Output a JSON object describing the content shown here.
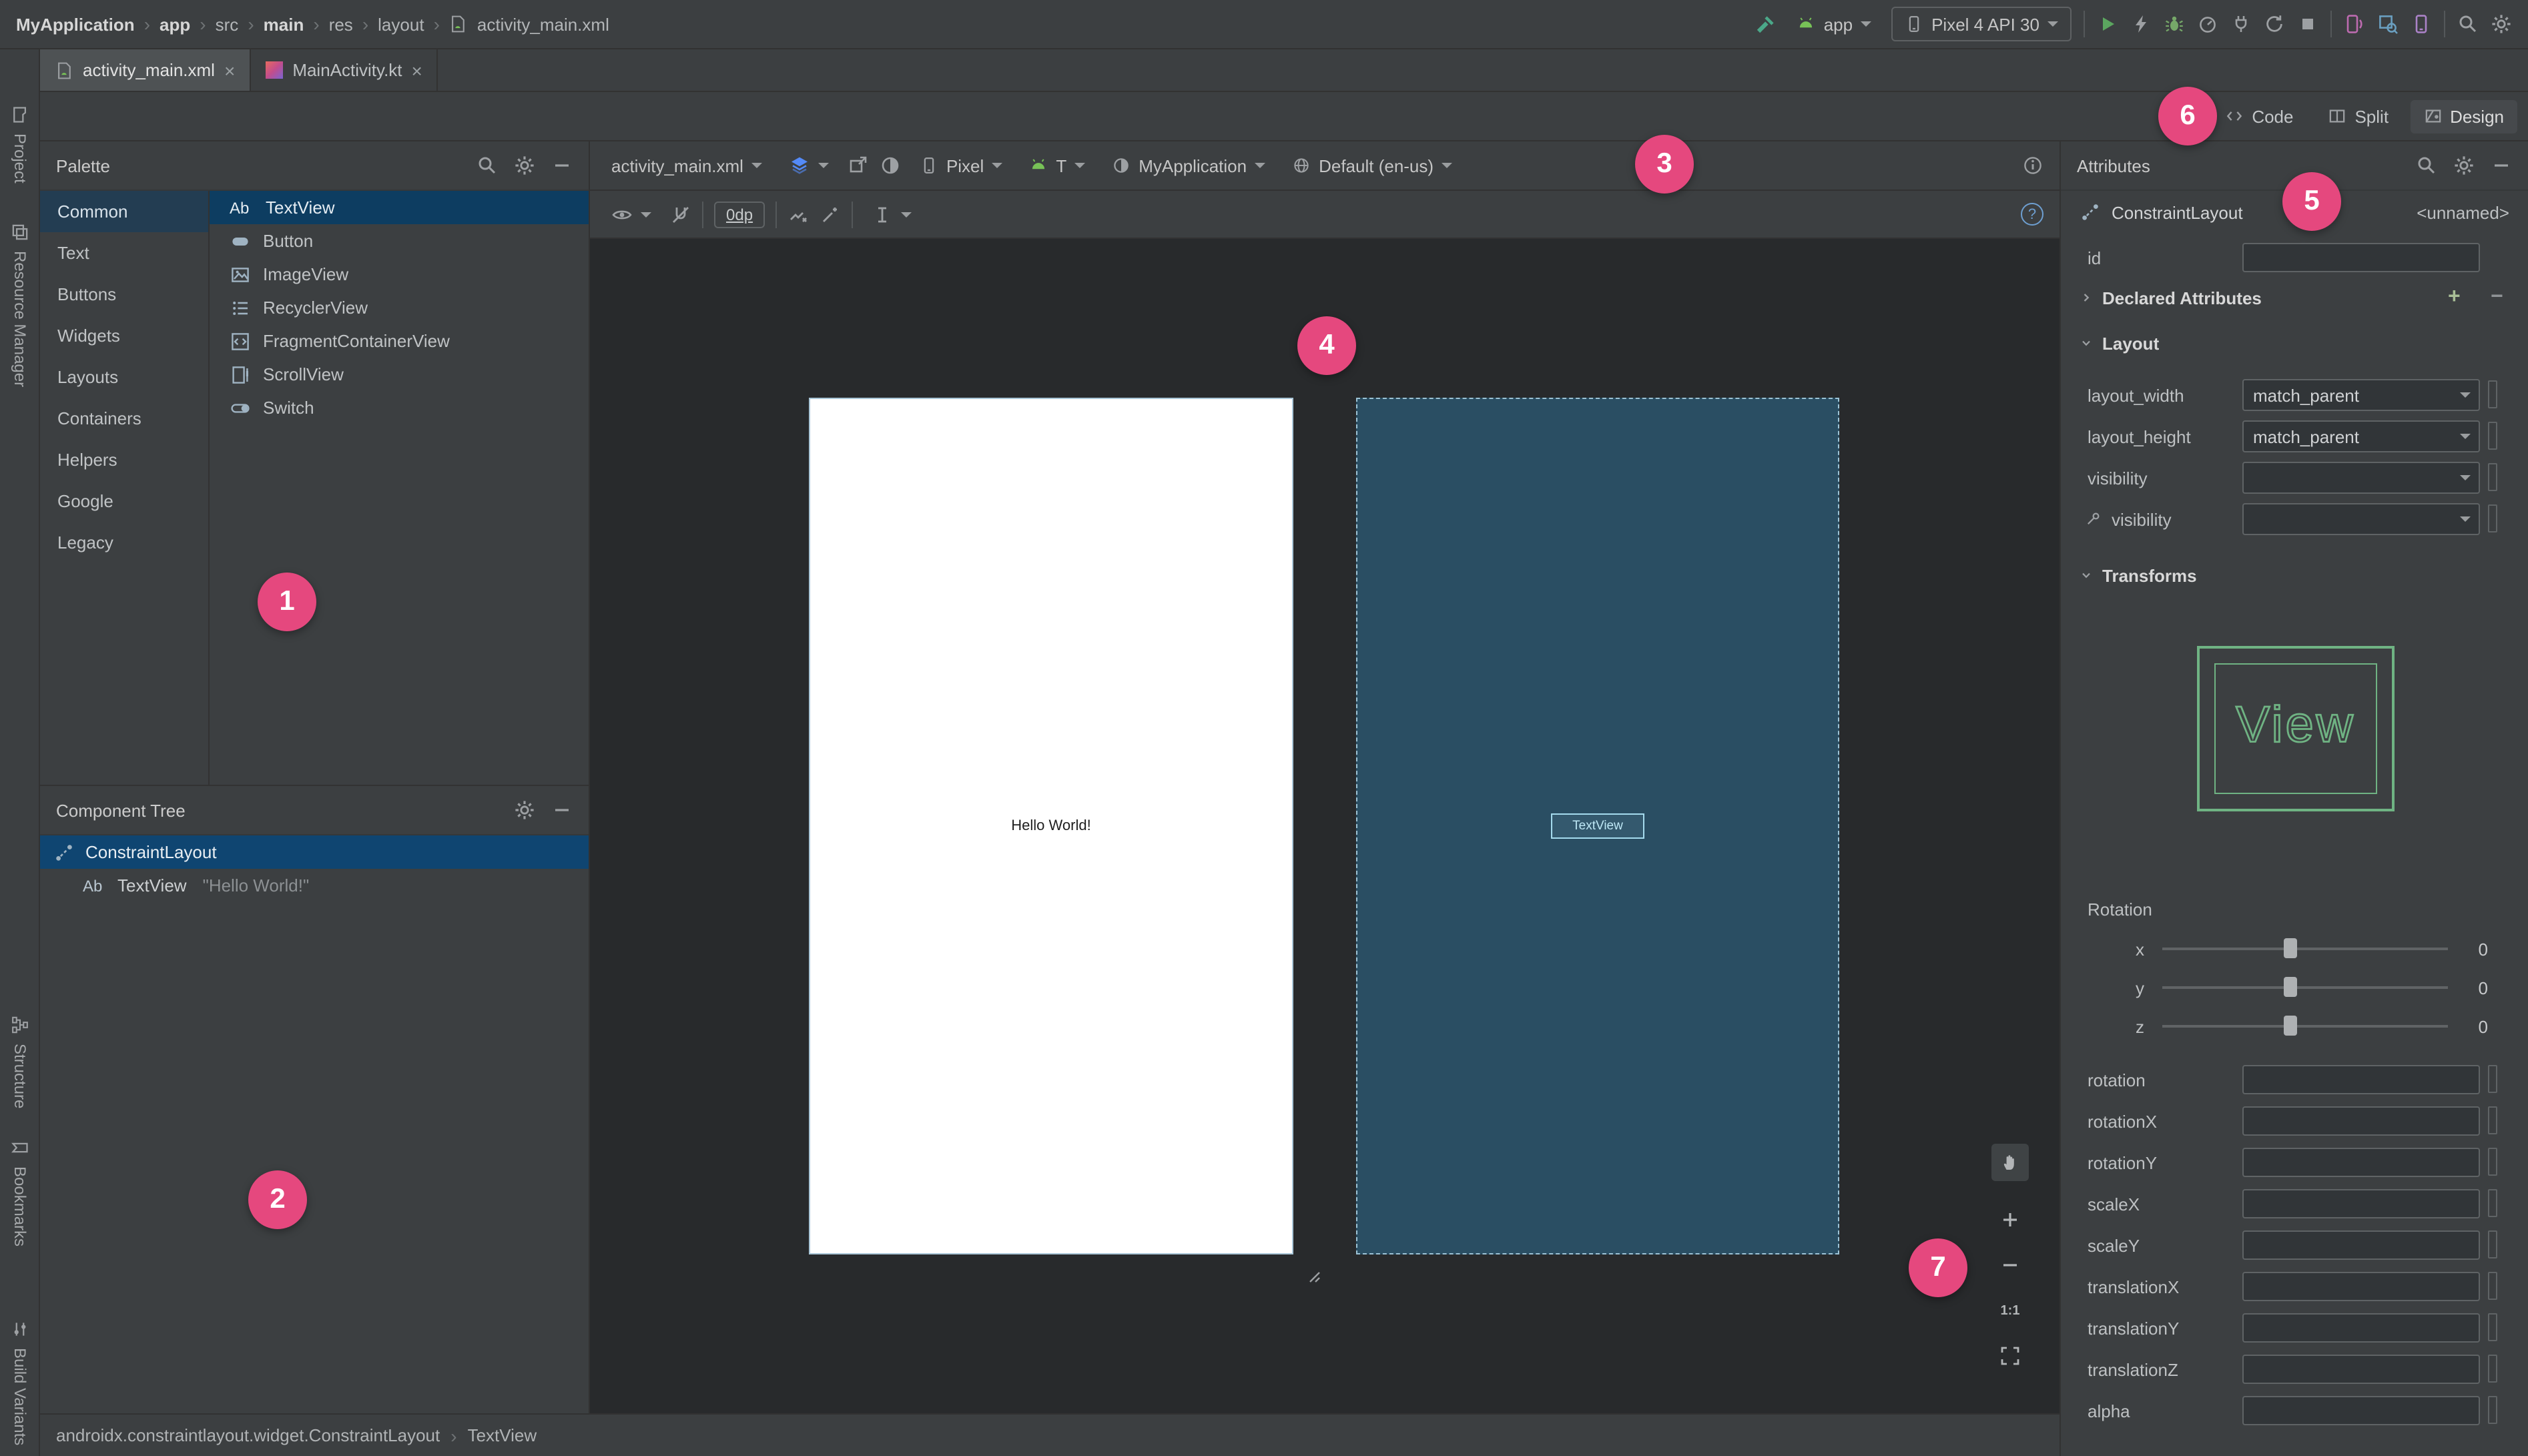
{
  "breadcrumbs": [
    "MyApplication",
    "app",
    "src",
    "main",
    "res",
    "layout",
    "activity_main.xml"
  ],
  "toolbar": {
    "run_config": "app",
    "device": "Pixel 4 API 30"
  },
  "tabs": {
    "tab1": "activity_main.xml",
    "tab2": "MainActivity.kt"
  },
  "view_modes": {
    "code": "Code",
    "split": "Split",
    "design": "Design"
  },
  "left_stripe": {
    "project": "Project",
    "resource_manager": "Resource Manager",
    "structure": "Structure",
    "bookmarks": "Bookmarks",
    "build_variants": "Build Variants"
  },
  "palette": {
    "title": "Palette",
    "categories": [
      "Common",
      "Text",
      "Buttons",
      "Widgets",
      "Layouts",
      "Containers",
      "Helpers",
      "Google",
      "Legacy"
    ],
    "items": [
      "TextView",
      "Button",
      "ImageView",
      "RecyclerView",
      "FragmentContainerView",
      "ScrollView",
      "Switch"
    ]
  },
  "design_toolbar": {
    "file": "activity_main.xml",
    "margin": "0dp",
    "device": "Pixel",
    "api": "T",
    "theme": "MyApplication",
    "locale": "Default (en-us)"
  },
  "canvas": {
    "design_text": "Hello World!",
    "blueprint_widget": "TextView"
  },
  "zoom_controls": {
    "reset": "1:1"
  },
  "component_tree": {
    "title": "Component Tree",
    "root": "ConstraintLayout",
    "child": "TextView",
    "child_note": "\"Hello World!\""
  },
  "attributes": {
    "title": "Attributes",
    "component": "ConstraintLayout",
    "component_name": "<unnamed>",
    "id_label": "id",
    "sections": {
      "declared": "Declared Attributes",
      "layout": "Layout",
      "transforms": "Transforms"
    },
    "layout_rows": [
      {
        "label": "layout_width",
        "value": "match_parent"
      },
      {
        "label": "layout_height",
        "value": "match_parent"
      },
      {
        "label": "visibility",
        "value": ""
      },
      {
        "label": "visibility",
        "value": ""
      }
    ],
    "view_preview": "View",
    "rotation_title": "Rotation",
    "axes": [
      {
        "axis": "x",
        "value": "0"
      },
      {
        "axis": "y",
        "value": "0"
      },
      {
        "axis": "z",
        "value": "0"
      }
    ],
    "transform_fields": [
      "rotation",
      "rotationX",
      "rotationY",
      "scaleX",
      "scaleY",
      "translationX",
      "translationY",
      "translationZ",
      "alpha"
    ]
  },
  "status_bar": {
    "path1": "androidx.constraintlayout.widget.ConstraintLayout",
    "path2": "TextView"
  },
  "annotations": [
    "1",
    "2",
    "3",
    "4",
    "5",
    "6",
    "7"
  ],
  "glyphs": {
    "close": "×",
    "plus": "+",
    "minus": "−",
    "chevron": "›",
    "help": "?",
    "ab": "Ab"
  },
  "colors": {
    "annotation_badge": "#E5487E",
    "selection_blue": "#0D3D61",
    "blueprint_fill": "#2A4E63",
    "android_green": "#78C257",
    "panel_bg": "#3C3F41",
    "surface_bg": "#282A2C"
  }
}
